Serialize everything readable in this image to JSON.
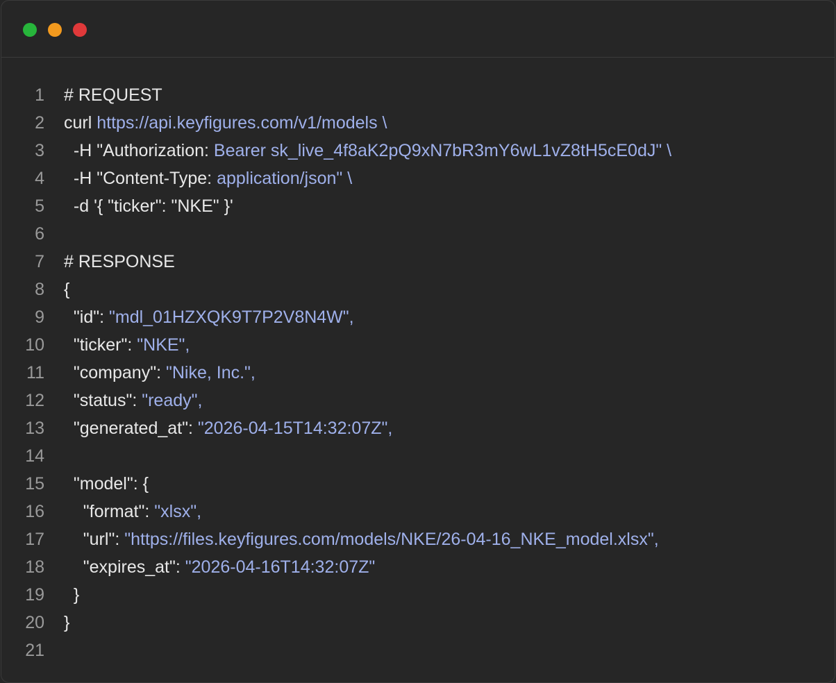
{
  "window": {
    "controls": [
      {
        "name": "green-dot",
        "color": "#27b53b"
      },
      {
        "name": "orange-dot",
        "color": "#f39a1e"
      },
      {
        "name": "red-dot",
        "color": "#e0393a"
      }
    ]
  },
  "colors": {
    "background": "#262626",
    "plain": "#e8e8e8",
    "string": "#9fb0ea",
    "line_number": "#9a9a9a"
  },
  "code": {
    "lines": [
      {
        "n": "1",
        "tokens": [
          {
            "t": "plain",
            "v": "# REQUEST"
          }
        ]
      },
      {
        "n": "2",
        "tokens": [
          {
            "t": "plain",
            "v": "curl "
          },
          {
            "t": "str",
            "v": "https://api.keyfigures.com/v1/models \\"
          }
        ]
      },
      {
        "n": "3",
        "tokens": [
          {
            "t": "plain",
            "v": "  -H \"Authorization: "
          },
          {
            "t": "str",
            "v": "Bearer sk_live_4f8aK2pQ9xN7bR3mY6wL1vZ8tH5cE0dJ\" \\"
          }
        ]
      },
      {
        "n": "4",
        "tokens": [
          {
            "t": "plain",
            "v": "  -H \"Content-Type: "
          },
          {
            "t": "str",
            "v": "application/json\" \\"
          }
        ]
      },
      {
        "n": "5",
        "tokens": [
          {
            "t": "plain",
            "v": "  -d '{ \"ticker\": \"NKE\" }'"
          }
        ]
      },
      {
        "n": "6",
        "tokens": []
      },
      {
        "n": "7",
        "tokens": [
          {
            "t": "plain",
            "v": "# RESPONSE"
          }
        ]
      },
      {
        "n": "8",
        "tokens": [
          {
            "t": "plain",
            "v": "{"
          }
        ]
      },
      {
        "n": "9",
        "tokens": [
          {
            "t": "plain",
            "v": "  \"id\": "
          },
          {
            "t": "str",
            "v": "\"mdl_01HZXQK9T7P2V8N4W\","
          }
        ]
      },
      {
        "n": "10",
        "tokens": [
          {
            "t": "plain",
            "v": "  \"ticker\": "
          },
          {
            "t": "str",
            "v": "\"NKE\","
          }
        ]
      },
      {
        "n": "11",
        "tokens": [
          {
            "t": "plain",
            "v": "  \"company\": "
          },
          {
            "t": "str",
            "v": "\"Nike, Inc.\","
          }
        ]
      },
      {
        "n": "12",
        "tokens": [
          {
            "t": "plain",
            "v": "  \"status\": "
          },
          {
            "t": "str",
            "v": "\"ready\","
          }
        ]
      },
      {
        "n": "13",
        "tokens": [
          {
            "t": "plain",
            "v": "  \"generated_at\": "
          },
          {
            "t": "str",
            "v": "\"2026-04-15T14:32:07Z\","
          }
        ]
      },
      {
        "n": "14",
        "tokens": []
      },
      {
        "n": "15",
        "tokens": [
          {
            "t": "plain",
            "v": "  \"model\": {"
          }
        ]
      },
      {
        "n": "16",
        "tokens": [
          {
            "t": "plain",
            "v": "    \"format\": "
          },
          {
            "t": "str",
            "v": "\"xlsx\","
          }
        ]
      },
      {
        "n": "17",
        "tokens": [
          {
            "t": "plain",
            "v": "    \"url\": "
          },
          {
            "t": "str",
            "v": "\"https://files.keyfigures.com/models/NKE/26-04-16_NKE_model.xlsx\","
          }
        ]
      },
      {
        "n": "18",
        "tokens": [
          {
            "t": "plain",
            "v": "    \"expires_at\": "
          },
          {
            "t": "str",
            "v": "\"2026-04-16T14:32:07Z\""
          }
        ]
      },
      {
        "n": "19",
        "tokens": [
          {
            "t": "plain",
            "v": "  }"
          }
        ]
      },
      {
        "n": "20",
        "tokens": [
          {
            "t": "plain",
            "v": "}"
          }
        ]
      },
      {
        "n": "21",
        "tokens": []
      }
    ]
  }
}
